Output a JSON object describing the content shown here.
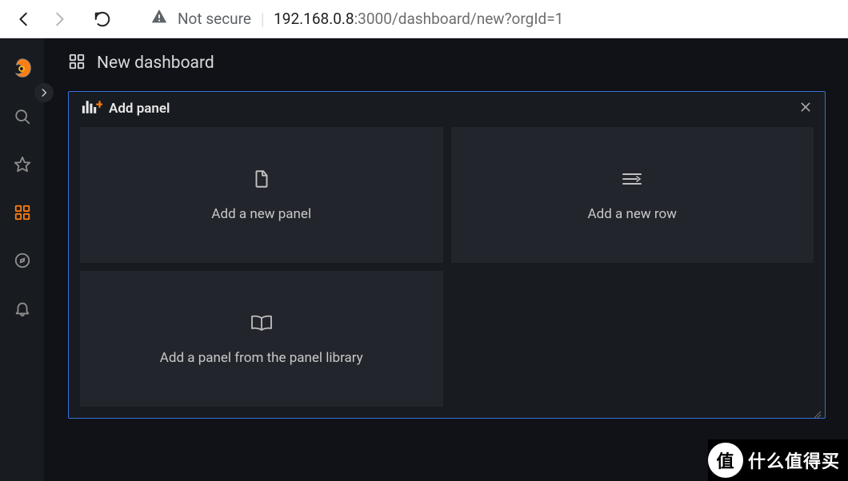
{
  "browser": {
    "not_secure_label": "Not secure",
    "url_host_prefix": "192.168.0.8",
    "url_host_port": ":3000",
    "url_path": "/dashboard/new?orgId=1"
  },
  "sidebar": {
    "items": [
      {
        "name": "grafana-logo"
      },
      {
        "name": "search"
      },
      {
        "name": "starred"
      },
      {
        "name": "dashboards"
      },
      {
        "name": "explore"
      },
      {
        "name": "alerting"
      }
    ]
  },
  "page": {
    "title": "New dashboard"
  },
  "wizard": {
    "title": "Add panel",
    "cards": {
      "new_panel": "Add a new panel",
      "new_row": "Add a new row",
      "from_library": "Add a panel from the panel library"
    }
  },
  "watermark": {
    "badge": "值",
    "text": "什么值得买"
  }
}
